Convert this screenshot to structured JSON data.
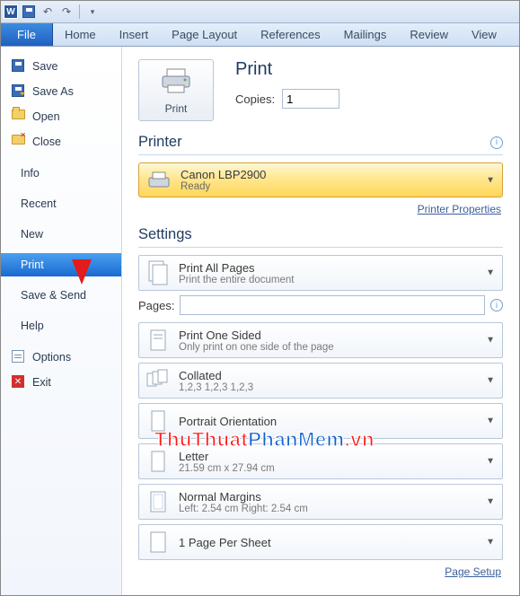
{
  "qat": {
    "app_letter": "W"
  },
  "ribbon": {
    "file": "File",
    "tabs": [
      "Home",
      "Insert",
      "Page Layout",
      "References",
      "Mailings",
      "Review",
      "View"
    ]
  },
  "sidebar": {
    "save": "Save",
    "save_as": "Save As",
    "open": "Open",
    "close": "Close",
    "info": "Info",
    "recent": "Recent",
    "new": "New",
    "print": "Print",
    "save_send": "Save & Send",
    "help": "Help",
    "options": "Options",
    "exit": "Exit"
  },
  "print": {
    "title": "Print",
    "button": "Print",
    "copies_label": "Copies:",
    "copies_value": "1"
  },
  "printer": {
    "heading": "Printer",
    "name": "Canon LBP2900",
    "status": "Ready",
    "properties_link": "Printer Properties"
  },
  "settings": {
    "heading": "Settings",
    "print_all": {
      "title": "Print All Pages",
      "sub": "Print the entire document"
    },
    "pages_label": "Pages:",
    "pages_value": "",
    "one_sided": {
      "title": "Print One Sided",
      "sub": "Only print on one side of the page"
    },
    "collated": {
      "title": "Collated",
      "sub": "1,2,3   1,2,3   1,2,3"
    },
    "orientation": {
      "title": "Portrait Orientation",
      "sub": ""
    },
    "paper": {
      "title": "Letter",
      "sub": "21.59 cm x 27.94 cm"
    },
    "margins": {
      "title": "Normal Margins",
      "sub": "Left: 2.54 cm   Right: 2.54 cm"
    },
    "per_sheet": {
      "title": "1 Page Per Sheet",
      "sub": ""
    },
    "page_setup_link": "Page Setup"
  },
  "watermark": {
    "a": "ThuThuat",
    "b": "PhanMem",
    "c": ".vn"
  }
}
